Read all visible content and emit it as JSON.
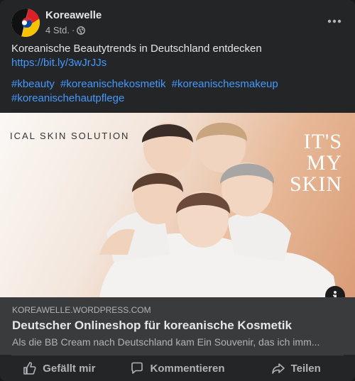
{
  "post": {
    "page_name": "Koreawelle",
    "timestamp": "4 Std.",
    "separator": "·",
    "audience_icon": "globe-icon",
    "message_text": "Koreanische Beautytrends in Deutschland entdecken",
    "message_link": "https://bit.ly/3wJrJJs",
    "hashtags": [
      "#kbeauty",
      "#koreanischekosmetik",
      "#koreanischesmakeup",
      "#koreanischehautpflege"
    ]
  },
  "image": {
    "headline": "ICAL SKIN SOLUTION",
    "side_text": [
      "IT'S",
      "MY",
      "SKIN"
    ]
  },
  "link_preview": {
    "domain": "KOREAWELLE.WORDPRESS.COM",
    "title": "Deutscher Onlineshop für koreanische Kosmetik",
    "description": "Als die BB Cream nach Deutschland kam Ein Souvenir, das ich imm..."
  },
  "actions": {
    "like_label": "Gefällt mir",
    "comment_label": "Kommentieren",
    "share_label": "Teilen"
  },
  "colors": {
    "link": "#4599ff",
    "card_bg": "#242526",
    "preview_bg": "#3a3b3c"
  }
}
